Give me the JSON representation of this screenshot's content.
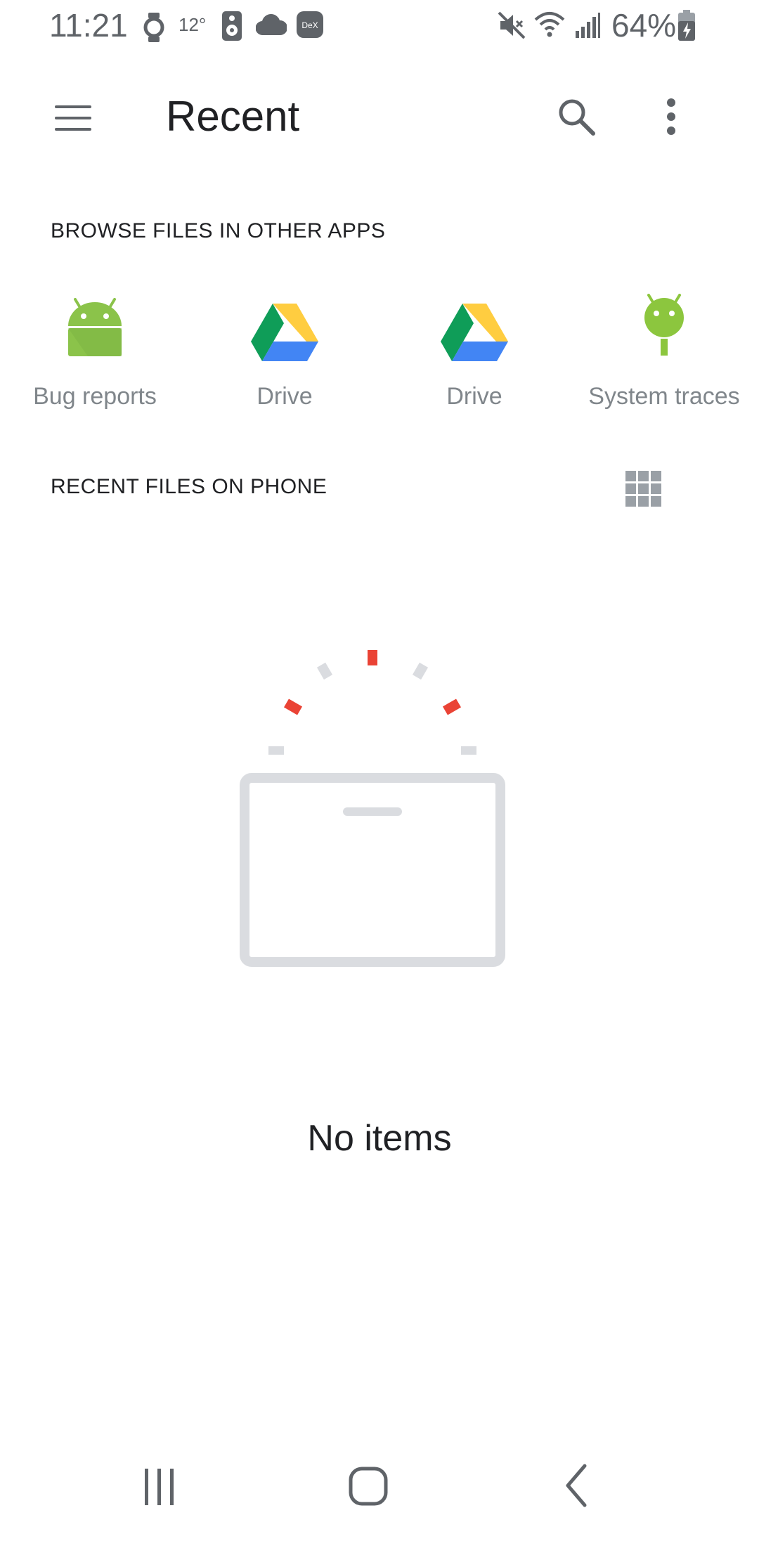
{
  "status_bar": {
    "time": "11:21",
    "temperature": "12°",
    "dex_label": "DeX",
    "battery": "64%",
    "icons": [
      "watch-icon",
      "speaker-icon",
      "cloud-icon",
      "dex-icon",
      "mute-icon",
      "wifi-icon",
      "signal-icon",
      "battery-icon"
    ]
  },
  "app_bar": {
    "title": "Recent",
    "icons": [
      "menu-icon",
      "search-icon",
      "more-vert-icon"
    ]
  },
  "browse_section": {
    "header": "BROWSE FILES IN OTHER APPS",
    "apps": [
      {
        "label": "Bug reports",
        "icon": "android-icon"
      },
      {
        "label": "Drive",
        "icon": "google-drive-icon"
      },
      {
        "label": "Drive",
        "icon": "google-drive-icon"
      },
      {
        "label": "System traces",
        "icon": "android-trace-icon"
      }
    ]
  },
  "recent_section": {
    "header": "RECENT FILES ON PHONE",
    "view_toggle_icon": "grid-view-icon"
  },
  "empty_state": {
    "message": "No items",
    "illustration": "empty-box-icon"
  },
  "nav_bar": {
    "icons": [
      "recent-apps-icon",
      "home-icon",
      "back-icon"
    ]
  },
  "colors": {
    "accent_red": "#EA4335",
    "android_green": "#8BC34A",
    "trace_green": "#8CC63E",
    "drive_green": "#0F9D58",
    "drive_yellow": "#FFCD40",
    "drive_blue": "#4285F4",
    "gray_text": "#80868B"
  }
}
